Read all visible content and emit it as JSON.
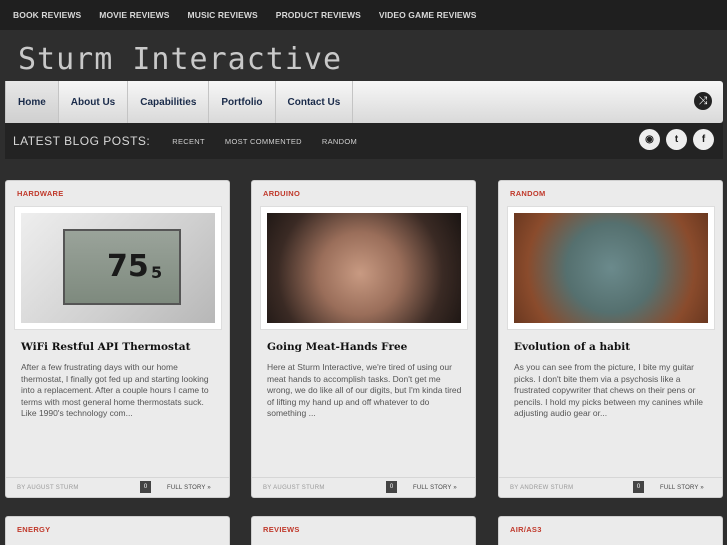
{
  "topnav": [
    "BOOK REVIEWS",
    "MOVIE REVIEWS",
    "MUSIC REVIEWS",
    "PRODUCT REVIEWS",
    "VIDEO GAME REVIEWS"
  ],
  "site": {
    "title": "Sturm Interactive"
  },
  "mainnav": [
    "Home",
    "About Us",
    "Capabilities",
    "Portfolio",
    "Contact Us"
  ],
  "subbar": {
    "title": "LATEST BLOG POSTS:",
    "links": [
      "RECENT",
      "MOST COMMENTED",
      "RANDOM"
    ]
  },
  "posts": [
    {
      "category": "HARDWARE",
      "title": "WiFi Restful API Thermostat",
      "excerpt": "After a few frustrating days with our home thermostat, I finally got fed up and starting looking into a replacement. After a couple hours I came to terms with most general home thermostats suck. Like 1990's technology com...",
      "author": "BY AUGUST STURM",
      "comments": "0",
      "more": "FULL STORY »"
    },
    {
      "category": "ARDUINO",
      "title": "Going Meat-Hands Free",
      "excerpt": "Here at Sturm Interactive, we're tired of using our meat hands to accomplish tasks. Don't get me wrong, we do like all of our digits, but I'm kinda tired of lifting my hand up and off whatever to do something ...",
      "author": "BY AUGUST STURM",
      "comments": "0",
      "more": "FULL STORY »"
    },
    {
      "category": "RANDOM",
      "title": "Evolution of a habit",
      "excerpt": "As you can see from the picture, I bite my guitar picks. I don't bite them via a psychosis like a frustrated copywriter that chews on their pens or pencils. I hold my picks between my canines while adjusting audio gear or...",
      "author": "BY ANDREW STURM",
      "comments": "0",
      "more": "FULL STORY »"
    }
  ],
  "next_categories": [
    "ENERGY",
    "REVIEWS",
    "AIR/AS3"
  ],
  "thermostat": {
    "temp": "75",
    "temp_decimal": "5"
  }
}
